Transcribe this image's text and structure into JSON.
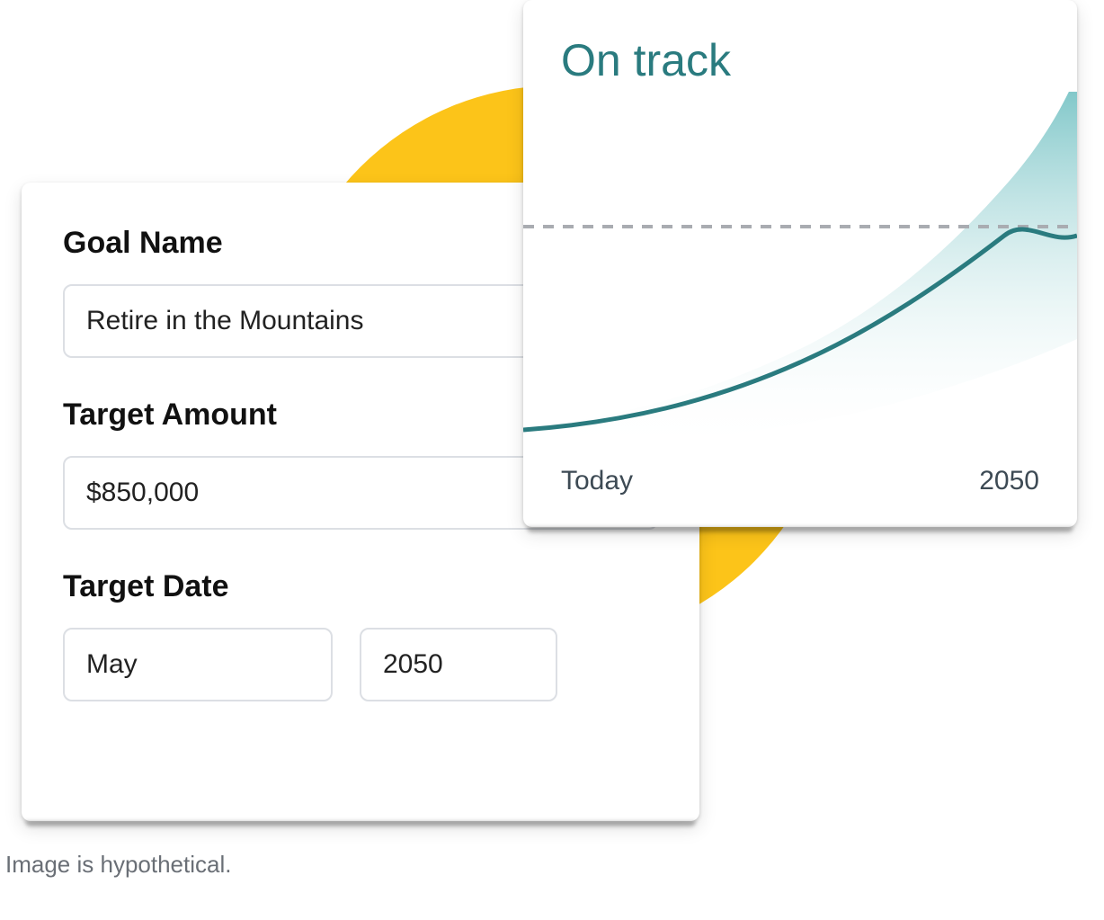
{
  "colors": {
    "accent_circle": "#fcc419",
    "chart_line": "#2a7b7f",
    "chart_fill_top": "#6ebfc1",
    "chart_fill_bottom": "#ffffff",
    "dashed_line": "#a9acb1"
  },
  "form": {
    "goal_name_label": "Goal Name",
    "goal_name_value": "Retire in the Mountains",
    "target_amount_label": "Target Amount",
    "target_amount_value": "$850,000",
    "target_date_label": "Target Date",
    "target_date_month": "May",
    "target_date_year": "2050"
  },
  "chart": {
    "status_title": "On track",
    "x_start_label": "Today",
    "x_end_label": "2050"
  },
  "chart_data": {
    "type": "area",
    "title": "On track",
    "xlabel": "",
    "ylabel": "",
    "x_range_labels": [
      "Today",
      "2050"
    ],
    "target_line_y": 0.58,
    "x": [
      0.0,
      0.1,
      0.2,
      0.3,
      0.4,
      0.5,
      0.6,
      0.7,
      0.8,
      0.85,
      0.9,
      0.95,
      1.0
    ],
    "series": [
      {
        "name": "projection_median",
        "values": [
          0.1,
          0.13,
          0.17,
          0.22,
          0.28,
          0.35,
          0.43,
          0.52,
          0.62,
          0.68,
          0.74,
          0.58,
          0.62
        ]
      },
      {
        "name": "projection_upper",
        "values": [
          0.1,
          0.16,
          0.23,
          0.32,
          0.42,
          0.54,
          0.67,
          0.81,
          0.95,
          1.02,
          1.1,
          1.18,
          1.26
        ]
      },
      {
        "name": "projection_lower",
        "values": [
          0.1,
          0.11,
          0.12,
          0.14,
          0.16,
          0.19,
          0.22,
          0.26,
          0.3,
          0.33,
          0.36,
          0.39,
          0.42
        ]
      }
    ],
    "ylim": [
      0,
      1.3
    ]
  },
  "footer": {
    "disclaimer": "Image is hypothetical."
  }
}
